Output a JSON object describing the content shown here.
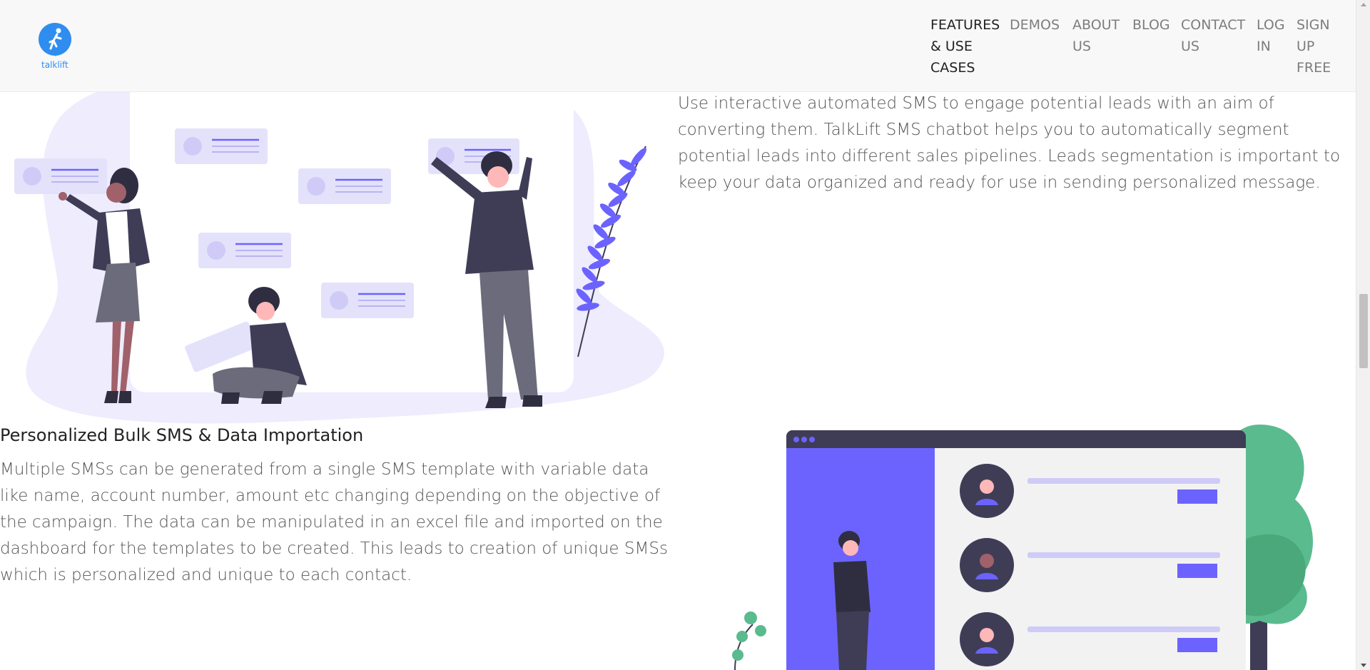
{
  "brand": {
    "logo_text": "talklift",
    "logo_color": "#2f8df0"
  },
  "nav": {
    "features": "FEATURES & USE CASES",
    "demos": "DEMOS",
    "about": "ABOUT US",
    "blog": "BLOG",
    "contact": "CONTACT US",
    "login": "LOG IN",
    "signup": "SIGN UP FREE"
  },
  "lead_section": {
    "text": "Use interactive automated SMS to engage potential leads with an aim of converting them. TalkLift SMS chatbot helps you to automatically segment potential leads into different sales pipelines. Leads segmentation is important to keep your data organized and ready for use in sending personalized message."
  },
  "bulk_section": {
    "title": "Personalized Bulk SMS & Data Importation",
    "text": "Multiple SMSs can be generated from a single SMS template with variable data like name, account number, amount etc changing depending on the objective of the campaign. The data can be manipulated in an excel file and imported on the dashboard for the templates to be created. This leads to creation of unique SMSs which is personalized and unique to each contact."
  },
  "colors": {
    "accent_purple": "#6c63ff",
    "light_purple": "#e4e2fb",
    "dark_figure": "#3f3d56",
    "plant_green": "#5abb8e"
  }
}
